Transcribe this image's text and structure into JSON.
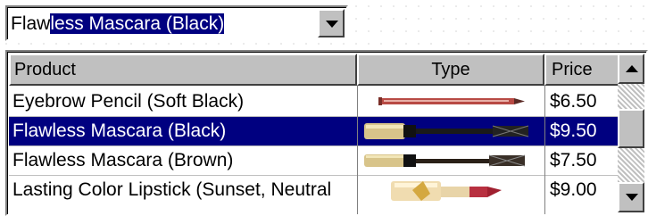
{
  "combo": {
    "typed_text": "Flaw",
    "selected_completion": "less Mascara (Black)"
  },
  "grid": {
    "columns": [
      "Product",
      "Type",
      "Price"
    ],
    "rows": [
      {
        "product": "Eyebrow Pencil (Soft Black)",
        "type_icon": "eyebrow-pencil-image",
        "price": "$6.50",
        "selected": false
      },
      {
        "product": "Flawless Mascara (Black)",
        "type_icon": "mascara-black-image",
        "price": "$9.50",
        "selected": true
      },
      {
        "product": "Flawless Mascara (Brown)",
        "type_icon": "mascara-brown-image",
        "price": "$7.50",
        "selected": false
      },
      {
        "product": "Lasting Color Lipstick (Sunset, Neutral",
        "type_icon": "lipstick-image",
        "price": "$9.00",
        "selected": false
      }
    ]
  },
  "colors": {
    "selection": "#000080",
    "chrome": "#c0c0c0"
  }
}
